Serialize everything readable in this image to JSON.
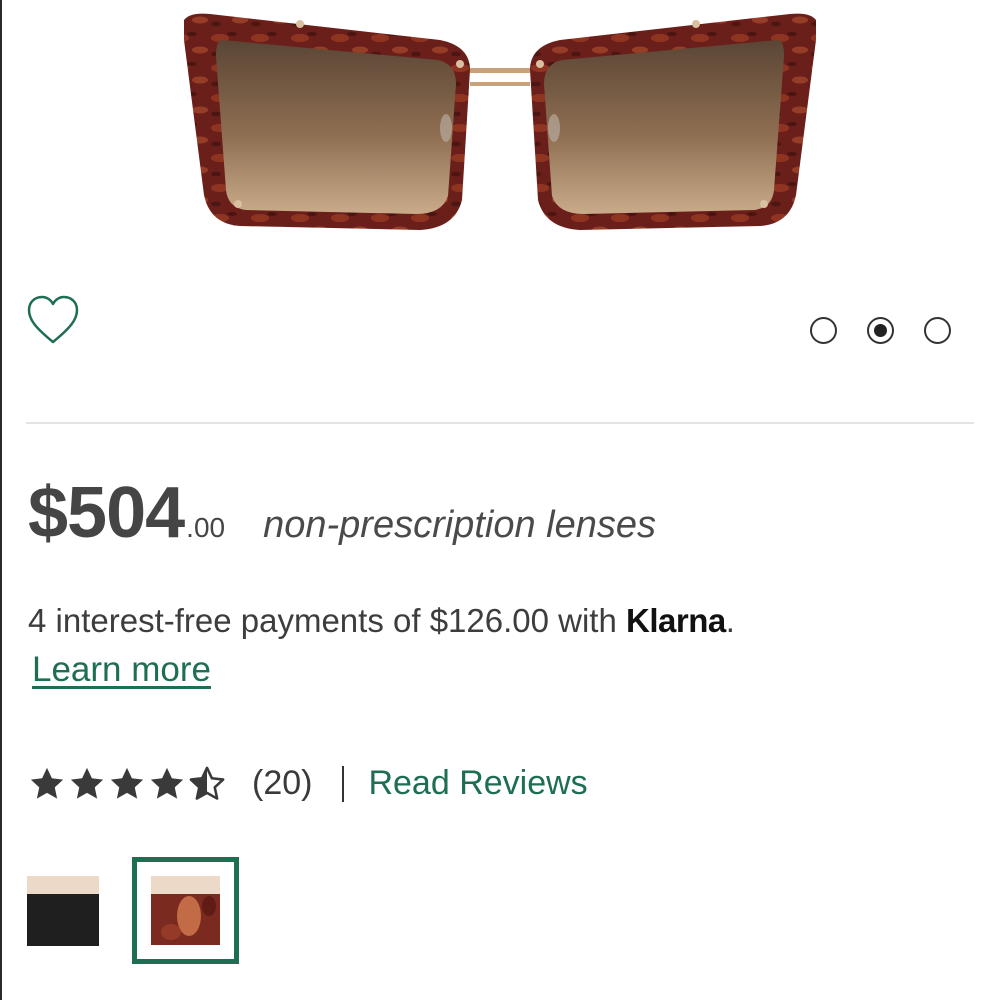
{
  "product": {
    "image_alt": "Maui Jim tortoise cat-eye sunglasses with bronze gradient lenses",
    "colors": {
      "frame": "#6b1f1a",
      "lens": "#8a6a4f",
      "accent": "#1e6e52"
    }
  },
  "gallery": {
    "dots": 3,
    "active_index": 1
  },
  "price": {
    "dollars": "$504",
    "cents": ".00",
    "lens_type": "non-prescription lenses"
  },
  "klarna": {
    "text": "4 interest-free payments of $126.00 with ",
    "brand": "Klarna",
    "suffix": ".",
    "learn_more": "Learn more"
  },
  "reviews": {
    "rating": 4.5,
    "max": 5,
    "count": "(20)",
    "link_label": "Read Reviews"
  },
  "swatches": [
    {
      "name": "black",
      "selected": false
    },
    {
      "name": "tortoise",
      "selected": true
    }
  ],
  "icons": {
    "wishlist": "heart-outline-icon",
    "star": "star-icon"
  }
}
